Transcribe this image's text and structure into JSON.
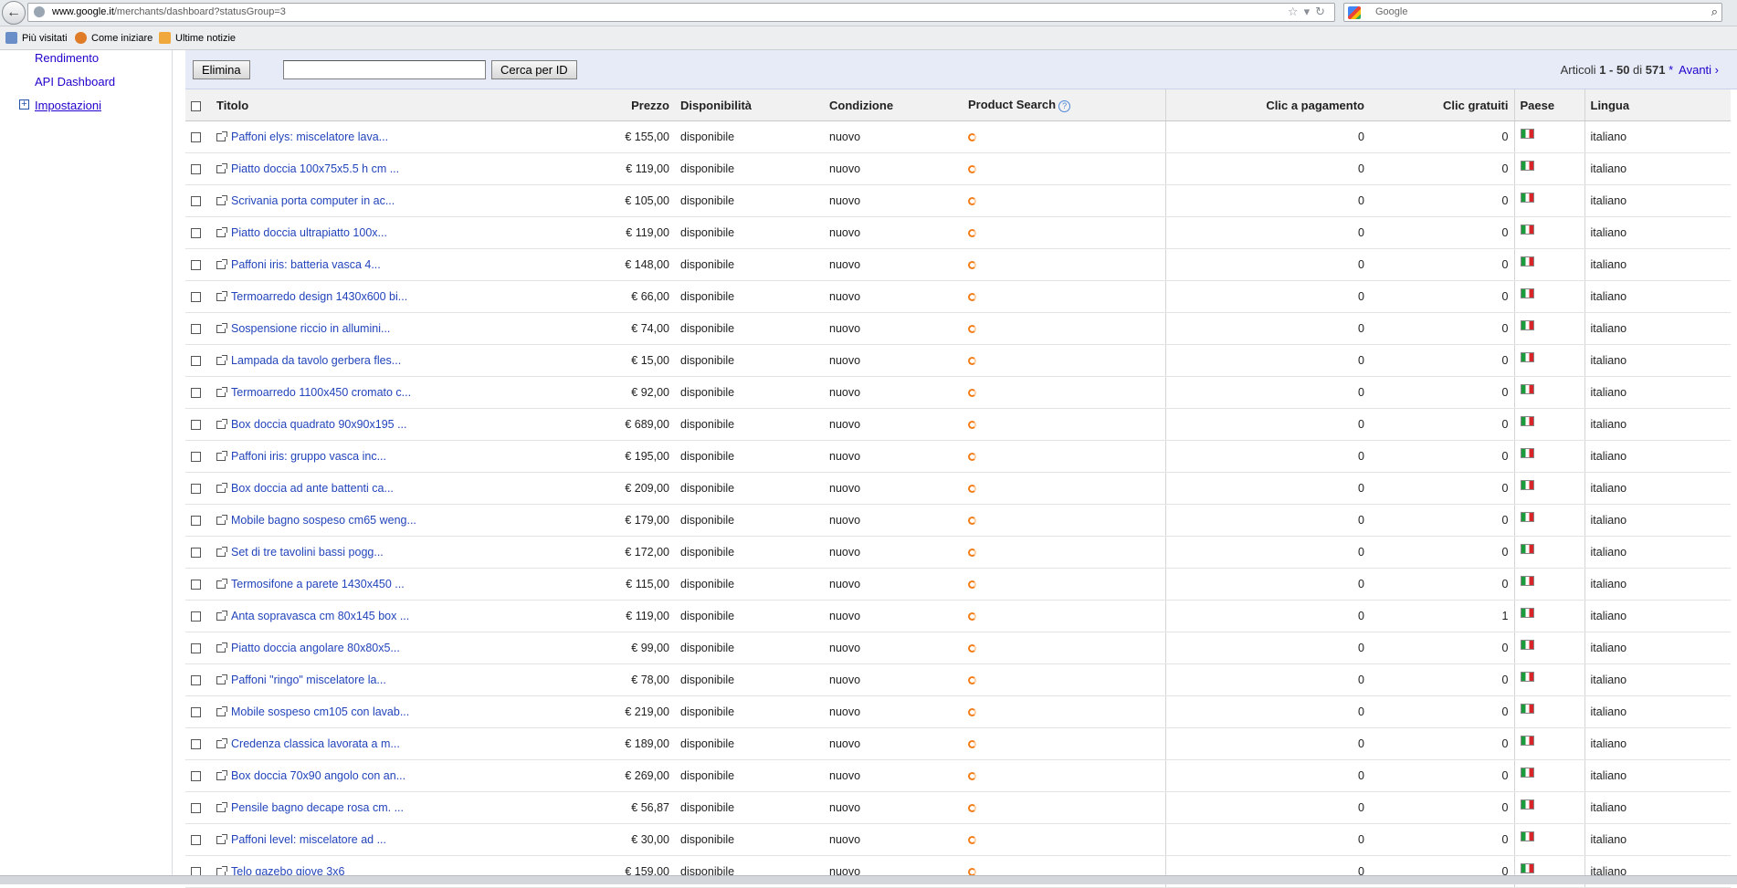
{
  "browser": {
    "url_host": "www.google.it",
    "url_path": "/merchants/dashboard?statusGroup=3",
    "search_placeholder": "Google",
    "bookmarks": [
      "Più visitati",
      "Come iniziare",
      "Ultime notizie"
    ]
  },
  "sidebar": {
    "items": [
      "Rendimento",
      "API Dashboard",
      "Impostazioni"
    ]
  },
  "toolbar": {
    "delete_label": "Elimina",
    "search_id_label": "Cerca per ID",
    "id_input_value": "",
    "count_prefix": "Articoli ",
    "count_range": "1 - 50",
    "count_of": " di ",
    "count_total": "571",
    "count_star": " *",
    "next_label": "Avanti ›"
  },
  "table": {
    "headers": {
      "title": "Titolo",
      "price": "Prezzo",
      "availability": "Disponibilità",
      "condition": "Condizione",
      "product_search": "Product Search",
      "paid_clicks": "Clic a pagamento",
      "free_clicks": "Clic gratuiti",
      "country": "Paese",
      "language": "Lingua"
    },
    "rows": [
      {
        "title": "Paffoni elys: miscelatore lava...",
        "price": "€ 155,00",
        "availability": "disponibile",
        "condition": "nuovo",
        "paid": "0",
        "free": "0",
        "language": "italiano"
      },
      {
        "title": "Piatto doccia 100x75x5.5 h cm ...",
        "price": "€ 119,00",
        "availability": "disponibile",
        "condition": "nuovo",
        "paid": "0",
        "free": "0",
        "language": "italiano"
      },
      {
        "title": "Scrivania porta computer in ac...",
        "price": "€ 105,00",
        "availability": "disponibile",
        "condition": "nuovo",
        "paid": "0",
        "free": "0",
        "language": "italiano"
      },
      {
        "title": "Piatto doccia ultrapiatto 100x...",
        "price": "€ 119,00",
        "availability": "disponibile",
        "condition": "nuovo",
        "paid": "0",
        "free": "0",
        "language": "italiano"
      },
      {
        "title": "Paffoni iris: batteria vasca 4...",
        "price": "€ 148,00",
        "availability": "disponibile",
        "condition": "nuovo",
        "paid": "0",
        "free": "0",
        "language": "italiano"
      },
      {
        "title": "Termoarredo design 1430x600 bi...",
        "price": "€ 66,00",
        "availability": "disponibile",
        "condition": "nuovo",
        "paid": "0",
        "free": "0",
        "language": "italiano"
      },
      {
        "title": "Sospensione riccio in allumini...",
        "price": "€ 74,00",
        "availability": "disponibile",
        "condition": "nuovo",
        "paid": "0",
        "free": "0",
        "language": "italiano"
      },
      {
        "title": "Lampada da tavolo gerbera fles...",
        "price": "€ 15,00",
        "availability": "disponibile",
        "condition": "nuovo",
        "paid": "0",
        "free": "0",
        "language": "italiano"
      },
      {
        "title": "Termoarredo 1100x450 cromato c...",
        "price": "€ 92,00",
        "availability": "disponibile",
        "condition": "nuovo",
        "paid": "0",
        "free": "0",
        "language": "italiano"
      },
      {
        "title": "Box doccia quadrato 90x90x195 ...",
        "price": "€ 689,00",
        "availability": "disponibile",
        "condition": "nuovo",
        "paid": "0",
        "free": "0",
        "language": "italiano"
      },
      {
        "title": "Paffoni iris: gruppo vasca inc...",
        "price": "€ 195,00",
        "availability": "disponibile",
        "condition": "nuovo",
        "paid": "0",
        "free": "0",
        "language": "italiano"
      },
      {
        "title": "Box doccia ad ante battenti ca...",
        "price": "€ 209,00",
        "availability": "disponibile",
        "condition": "nuovo",
        "paid": "0",
        "free": "0",
        "language": "italiano"
      },
      {
        "title": "Mobile bagno sospeso cm65 weng...",
        "price": "€ 179,00",
        "availability": "disponibile",
        "condition": "nuovo",
        "paid": "0",
        "free": "0",
        "language": "italiano"
      },
      {
        "title": "Set di tre tavolini bassi pogg...",
        "price": "€ 172,00",
        "availability": "disponibile",
        "condition": "nuovo",
        "paid": "0",
        "free": "0",
        "language": "italiano"
      },
      {
        "title": "Termosifone a parete 1430x450 ...",
        "price": "€ 115,00",
        "availability": "disponibile",
        "condition": "nuovo",
        "paid": "0",
        "free": "0",
        "language": "italiano"
      },
      {
        "title": "Anta sopravasca cm 80x145 box ...",
        "price": "€ 119,00",
        "availability": "disponibile",
        "condition": "nuovo",
        "paid": "0",
        "free": "1",
        "language": "italiano"
      },
      {
        "title": "Piatto doccia angolare 80x80x5...",
        "price": "€ 99,00",
        "availability": "disponibile",
        "condition": "nuovo",
        "paid": "0",
        "free": "0",
        "language": "italiano"
      },
      {
        "title": "Paffoni \"ringo\" miscelatore la...",
        "price": "€ 78,00",
        "availability": "disponibile",
        "condition": "nuovo",
        "paid": "0",
        "free": "0",
        "language": "italiano"
      },
      {
        "title": "Mobile sospeso cm105 con lavab...",
        "price": "€ 219,00",
        "availability": "disponibile",
        "condition": "nuovo",
        "paid": "0",
        "free": "0",
        "language": "italiano"
      },
      {
        "title": "Credenza classica lavorata a m...",
        "price": "€ 189,00",
        "availability": "disponibile",
        "condition": "nuovo",
        "paid": "0",
        "free": "0",
        "language": "italiano"
      },
      {
        "title": "Box doccia 70x90 angolo con an...",
        "price": "€ 269,00",
        "availability": "disponibile",
        "condition": "nuovo",
        "paid": "0",
        "free": "0",
        "language": "italiano"
      },
      {
        "title": "Pensile bagno decape rosa cm. ...",
        "price": "€ 56,87",
        "availability": "disponibile",
        "condition": "nuovo",
        "paid": "0",
        "free": "0",
        "language": "italiano"
      },
      {
        "title": "Paffoni level: miscelatore ad ...",
        "price": "€ 30,00",
        "availability": "disponibile",
        "condition": "nuovo",
        "paid": "0",
        "free": "0",
        "language": "italiano"
      },
      {
        "title": "Telo gazebo giove 3x6",
        "price": "€ 159,00",
        "availability": "disponibile",
        "condition": "nuovo",
        "paid": "0",
        "free": "0",
        "language": "italiano"
      }
    ]
  },
  "colors": {
    "link": "#2244bb",
    "toolbar_bg": "#e6ebf7",
    "product_search_icon": "#f27f1b"
  }
}
